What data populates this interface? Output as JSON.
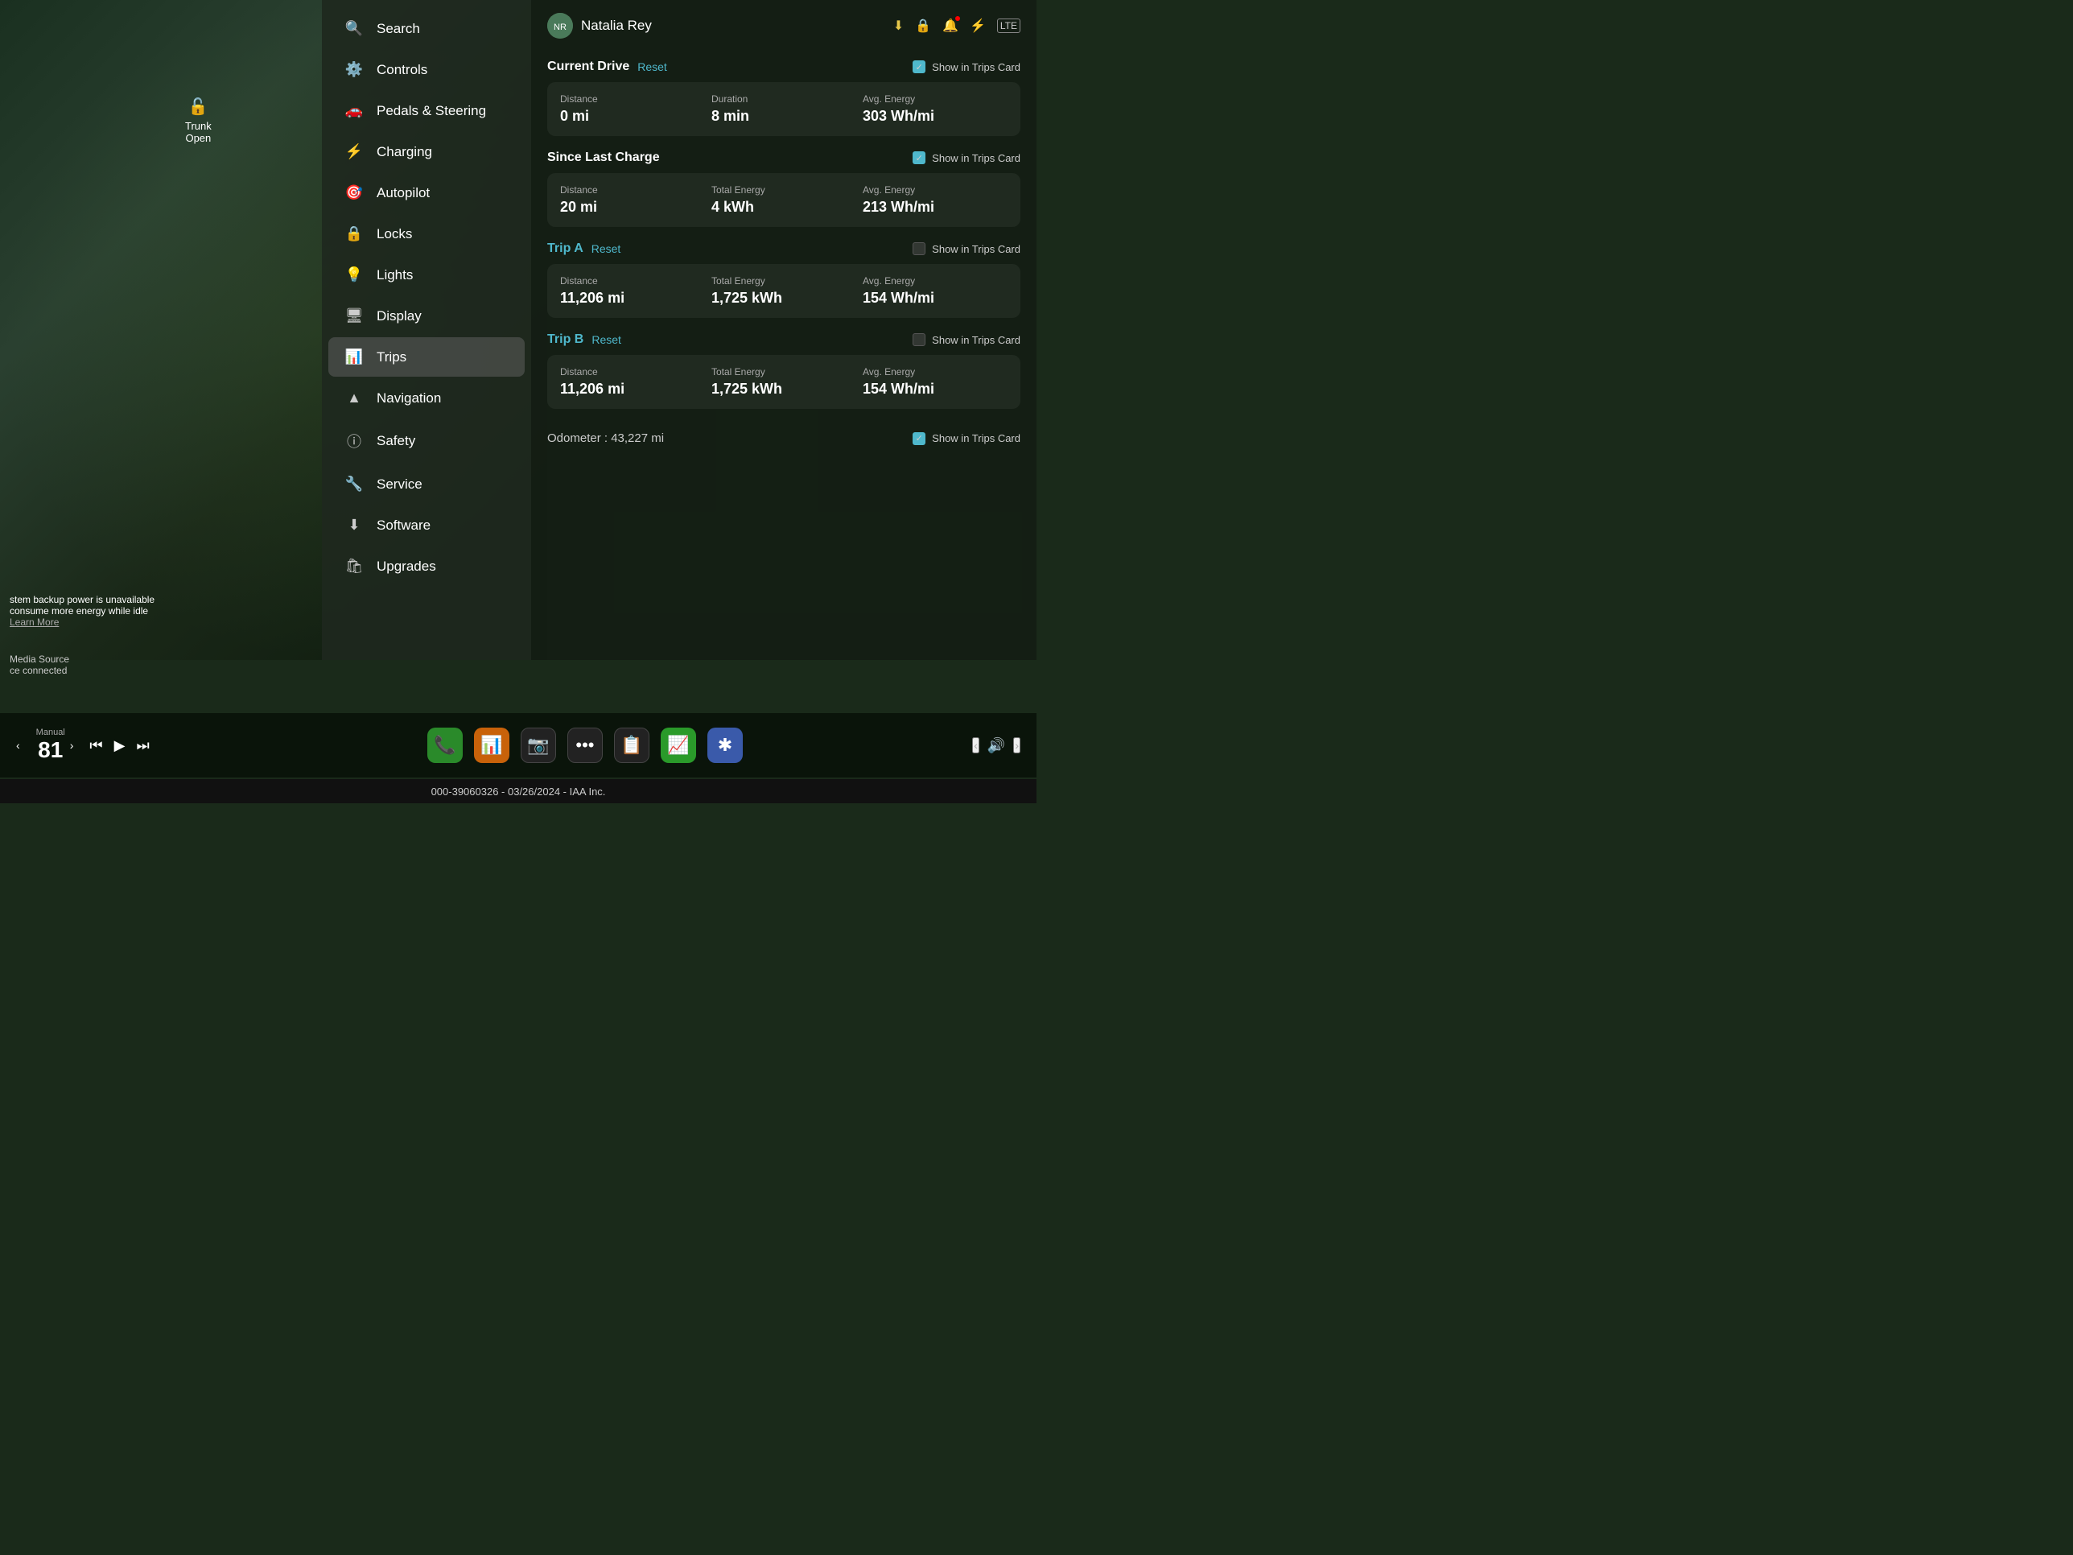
{
  "user": {
    "name": "Natalia Rey",
    "avatar_initials": "NR"
  },
  "status_icons": {
    "download": "⬇",
    "lock": "🔒",
    "bell": "🔔",
    "bluetooth": "⚡",
    "lte": "LTE"
  },
  "trunk": {
    "icon": "🔓",
    "line1": "Trunk",
    "line2": "Open"
  },
  "system_message": {
    "line1": "stem backup power is unavailable",
    "line2": "consume more energy while idle",
    "learn_more": "Learn More"
  },
  "media_source": {
    "label": "Media Source",
    "source": "ce connected"
  },
  "menu": {
    "items": [
      {
        "id": "search",
        "icon": "🔍",
        "label": "Search"
      },
      {
        "id": "controls",
        "icon": "⚙",
        "label": "Controls"
      },
      {
        "id": "pedals",
        "icon": "🚗",
        "label": "Pedals & Steering"
      },
      {
        "id": "charging",
        "icon": "⚡",
        "label": "Charging"
      },
      {
        "id": "autopilot",
        "icon": "🎯",
        "label": "Autopilot"
      },
      {
        "id": "locks",
        "icon": "🔒",
        "label": "Locks"
      },
      {
        "id": "lights",
        "icon": "💡",
        "label": "Lights"
      },
      {
        "id": "display",
        "icon": "🖥",
        "label": "Display"
      },
      {
        "id": "trips",
        "icon": "📊",
        "label": "Trips",
        "active": true
      },
      {
        "id": "navigation",
        "icon": "🧭",
        "label": "Navigation"
      },
      {
        "id": "safety",
        "icon": "⚠",
        "label": "Safety"
      },
      {
        "id": "service",
        "icon": "🔧",
        "label": "Service"
      },
      {
        "id": "software",
        "icon": "⬇",
        "label": "Software"
      },
      {
        "id": "upgrades",
        "icon": "🛍",
        "label": "Upgrades"
      }
    ]
  },
  "trips": {
    "current_drive": {
      "title": "Current Drive",
      "reset": "Reset",
      "show_trips": "Show in Trips Card",
      "checked": true,
      "distance_label": "Distance",
      "distance_value": "0 mi",
      "duration_label": "Duration",
      "duration_value": "8 min",
      "avg_energy_label": "Avg. Energy",
      "avg_energy_value": "303 Wh/mi"
    },
    "since_last_charge": {
      "title": "Since Last Charge",
      "show_trips": "Show in Trips Card",
      "checked": true,
      "distance_label": "Distance",
      "distance_value": "20 mi",
      "total_energy_label": "Total Energy",
      "total_energy_value": "4 kWh",
      "avg_energy_label": "Avg. Energy",
      "avg_energy_value": "213 Wh/mi"
    },
    "trip_a": {
      "title": "Trip A",
      "reset": "Reset",
      "show_trips": "Show in Trips Card",
      "checked": false,
      "distance_label": "Distance",
      "distance_value": "11,206 mi",
      "total_energy_label": "Total Energy",
      "total_energy_value": "1,725 kWh",
      "avg_energy_label": "Avg. Energy",
      "avg_energy_value": "154 Wh/mi"
    },
    "trip_b": {
      "title": "Trip B",
      "reset": "Reset",
      "show_trips": "Show in Trips Card",
      "checked": false,
      "distance_label": "Distance",
      "distance_value": "11,206 mi",
      "total_energy_label": "Total Energy",
      "total_energy_value": "1,725 kWh",
      "avg_energy_label": "Avg. Energy",
      "avg_energy_value": "154 Wh/mi"
    },
    "odometer": {
      "label": "Odometer :  43,227 mi",
      "show_trips": "Show in Trips Card",
      "checked": true
    }
  },
  "taskbar": {
    "speed_label": "Manual",
    "speed_value": "81",
    "prev_icon": "⏮",
    "play_icon": "▶",
    "next_icon": "⏭",
    "apps": [
      {
        "id": "phone",
        "icon": "📞",
        "class": "app-phone"
      },
      {
        "id": "chart",
        "icon": "📊",
        "class": "app-chart"
      },
      {
        "id": "camera",
        "icon": "📷",
        "class": "app-camera"
      },
      {
        "id": "dots",
        "icon": "•••",
        "class": "app-dots"
      },
      {
        "id": "info",
        "icon": "📋",
        "class": "app-info"
      },
      {
        "id": "green",
        "icon": "📈",
        "class": "app-green"
      },
      {
        "id": "bluetooth",
        "icon": "✱",
        "class": "app-bluetooth"
      }
    ],
    "volume_icon": "🔊"
  },
  "info_bar": {
    "text": "000-39060326 - 03/26/2024 - IAA Inc."
  }
}
